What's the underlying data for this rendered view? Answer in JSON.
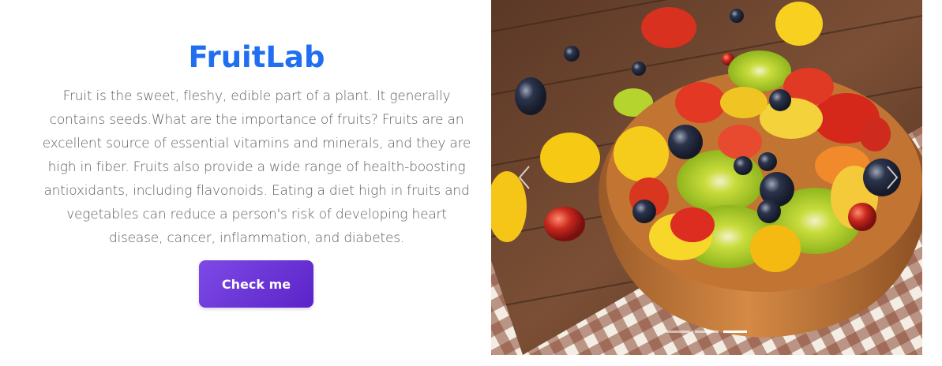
{
  "hero": {
    "title": "FruitLab",
    "description": "Fruit is the sweet, fleshy, edible part of a plant. It generally contains seeds.What are the importance of fruits? Fruits are an excellent source of essential vitamins and minerals, and they are high in fiber. Fruits also provide a wide range of health-boosting antioxidants, including flavonoids. Eating a diet high in fruits and vegetables can reduce a person's risk of developing heart disease, cancer, inflammation, and diabetes.",
    "button_label": "Check me"
  },
  "carousel": {
    "image_alt": "fruit salad bowl",
    "prev_icon": "chevron-left-icon",
    "next_icon": "chevron-right-icon",
    "slide_count": 3,
    "active_slide": 3
  },
  "colors": {
    "title": "#1f6ff0",
    "button_start": "#7d4ae6",
    "button_end": "#5b23c8",
    "text": "#5c5c66"
  }
}
